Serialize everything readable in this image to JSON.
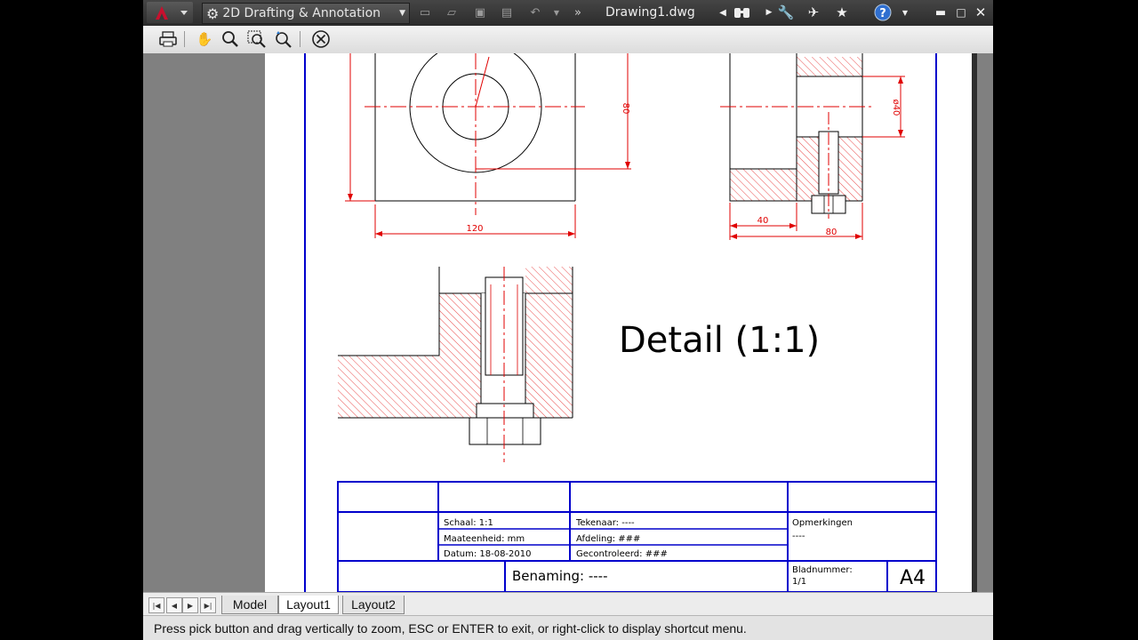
{
  "titlebar": {
    "workspace": "2D Drafting & Annotation",
    "document_title": "Drawing1.dwg",
    "icons": [
      "autocad-logo-icon",
      "gear-icon",
      "new-icon",
      "open-icon",
      "save-icon",
      "saveas-icon",
      "undo-icon",
      "redo-icon",
      "binoculars-icon",
      "wrench-icon",
      "satellite-icon",
      "star-icon",
      "help-icon",
      "minimize-icon",
      "restore-icon",
      "close-icon"
    ]
  },
  "toolbar": {
    "icons": [
      "print-icon",
      "pan-icon",
      "zoom-icon",
      "zoom-window-icon",
      "zoom-previous-icon",
      "close-preview-icon"
    ]
  },
  "drawing": {
    "dim_120": "120",
    "dim_80": "80",
    "dim_40_diam": "ø40",
    "dim_40": "40",
    "dim_80b": "80",
    "detail_label": "Detail (1:1)"
  },
  "titleblock": {
    "schaal": "Schaal: 1:1",
    "maateenheid": "Maateenheid: mm",
    "datum": "Datum: 18-08-2010",
    "tekenaar": "Tekenaar: ----",
    "afdeling": "Afdeling: ###",
    "gecontroleerd": "Gecontroleerd: ###",
    "opmerkingen": "Opmerkingen",
    "opmerkingen_value": "----",
    "benaming": "Benaming: ----",
    "bladnummer": "Bladnummer:",
    "bladnummer_value": "1/1",
    "format": "A4"
  },
  "tabs": {
    "items": [
      {
        "label": "Model"
      },
      {
        "label": "Layout1"
      },
      {
        "label": "Layout2"
      }
    ],
    "active": "Layout1"
  },
  "status": {
    "message": "Press pick button and drag vertically to zoom, ESC or ENTER to exit, or right-click to display shortcut menu."
  },
  "colors": {
    "drawing_red": "#e00000",
    "border_blue": "#0000cc"
  }
}
